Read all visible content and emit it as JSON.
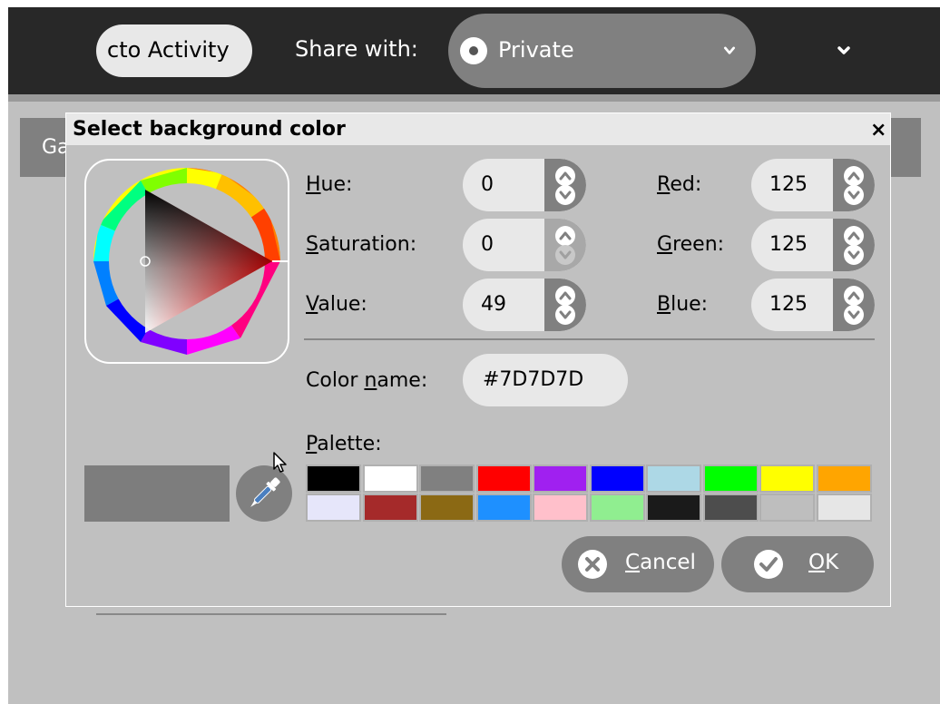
{
  "toolbar": {
    "activity_button_label": "cto Activity",
    "share_label": "Share with:",
    "share_value": "Private"
  },
  "background": {
    "tab_label": "Ga"
  },
  "dialog": {
    "title": "Select background color",
    "close_glyph": "×",
    "hue": {
      "mnemonic": "H",
      "rest": "ue:",
      "value": "0"
    },
    "saturation": {
      "mnemonic": "S",
      "rest": "aturation:",
      "value": "0"
    },
    "value_field": {
      "mnemonic": "V",
      "rest": "alue:",
      "value": "49"
    },
    "red": {
      "mnemonic": "R",
      "rest": "ed:",
      "value": "125"
    },
    "green": {
      "mnemonic": "G",
      "rest": "reen:",
      "value": "125"
    },
    "blue": {
      "mnemonic": "B",
      "rest": "lue:",
      "value": "125"
    },
    "color_name": {
      "prefix": "Color ",
      "mnemonic": "n",
      "rest": "ame:",
      "value": "#7D7D7D"
    },
    "palette": {
      "mnemonic": "P",
      "rest": "alette:"
    },
    "current_color": "#7D7D7D",
    "palette_colors": [
      "#000000",
      "#ffffff",
      "#808080",
      "#ff0000",
      "#a020f0",
      "#0000ff",
      "#add8e6",
      "#00ff00",
      "#ffff00",
      "#ffa500",
      "#e6e6fa",
      "#a52a2a",
      "#8b6914",
      "#1e90ff",
      "#ffc0cb",
      "#90ee90",
      "#1a1a1a",
      "#4d4d4d",
      "#bebebe",
      "#e6e6e6"
    ],
    "cancel": {
      "mnemonic": "C",
      "rest": "ancel"
    },
    "ok": {
      "mnemonic": "O",
      "rest": "K"
    }
  },
  "icons": {
    "share_radio": "radio-dot-icon",
    "share_dropdown": "chevron-down-icon",
    "toolbar_more": "chevron-down-icon",
    "close": "close-icon",
    "picker": "eyedropper-icon",
    "cancel": "cancel-icon",
    "ok": "checkmark-icon",
    "cursor": "mouse-pointer-icon"
  }
}
